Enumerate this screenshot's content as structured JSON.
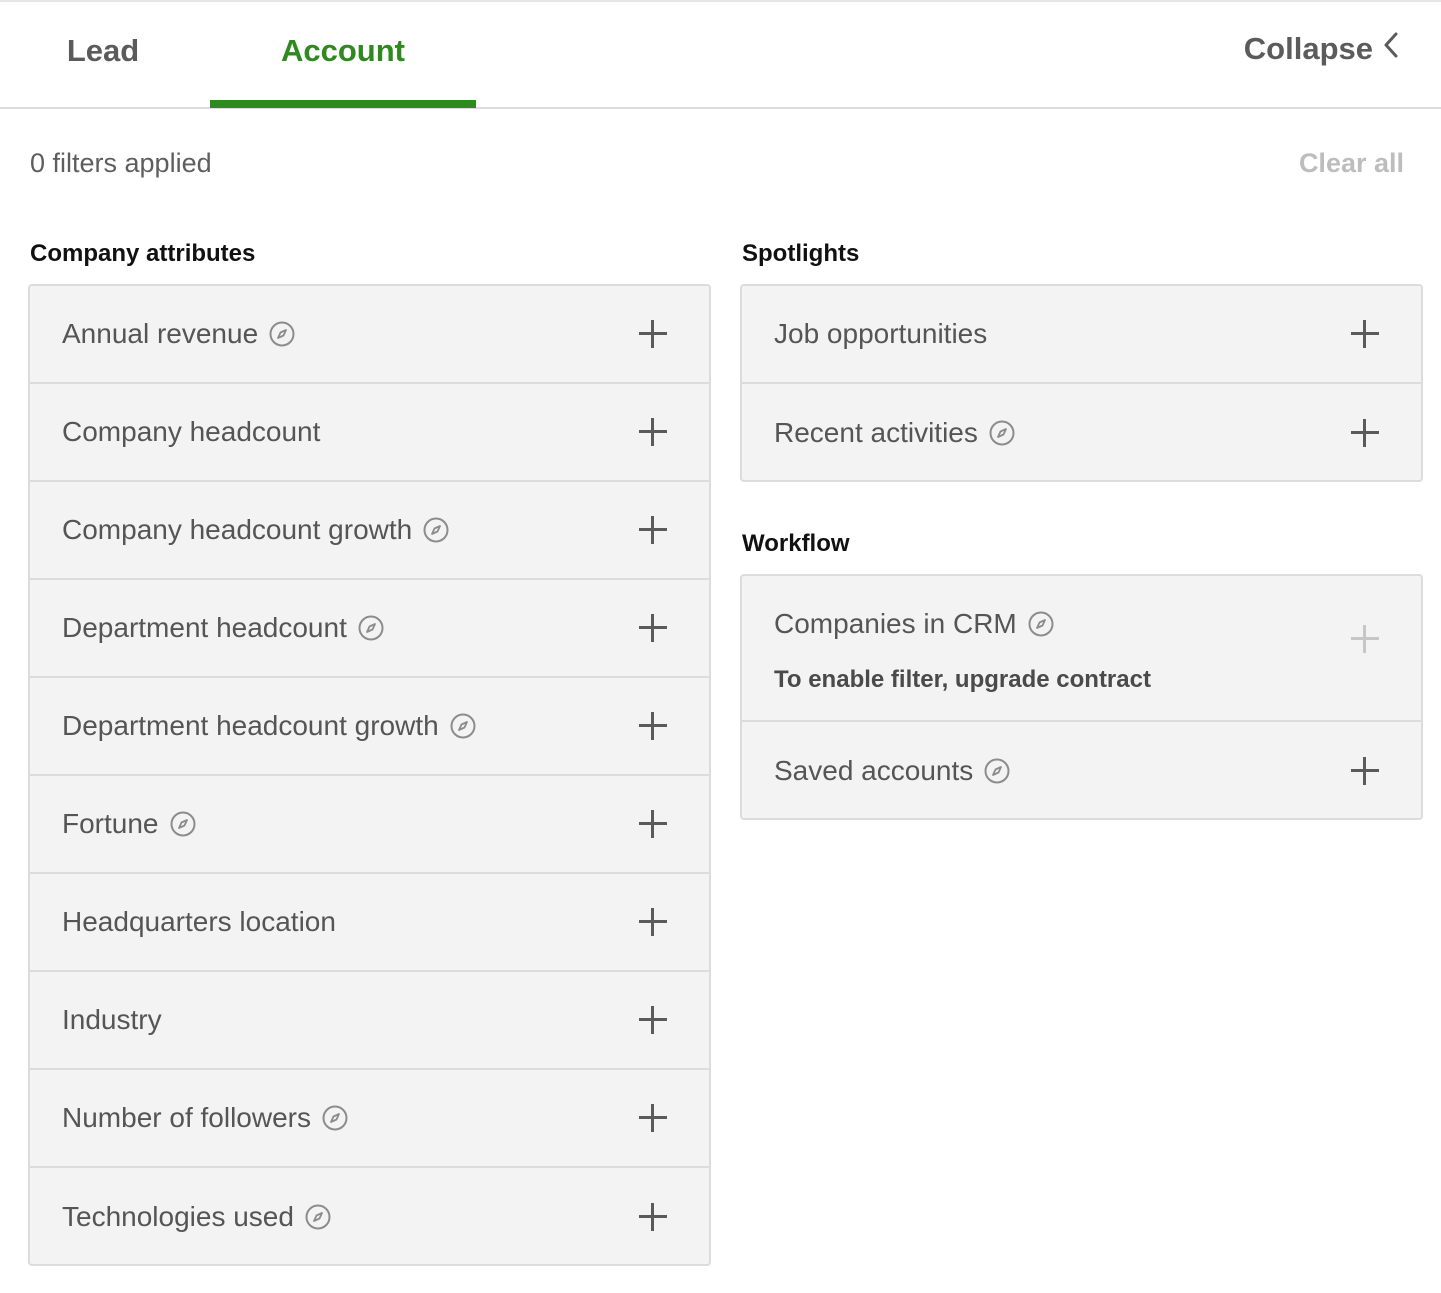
{
  "tabs": [
    {
      "label": "Lead",
      "active": false
    },
    {
      "label": "Account",
      "active": true
    }
  ],
  "header": {
    "collapse_label": "Collapse",
    "filters_applied": "0 filters applied",
    "clear_all": "Clear all"
  },
  "colors": {
    "accent": "#2e8a1e",
    "panel_bg": "#f3f3f4",
    "border": "#dcdcdc"
  },
  "company_attributes": {
    "title": "Company attributes",
    "items": [
      {
        "label": "Annual revenue",
        "info": true
      },
      {
        "label": "Company headcount",
        "info": false
      },
      {
        "label": "Company headcount growth",
        "info": true
      },
      {
        "label": "Department headcount",
        "info": true
      },
      {
        "label": "Department headcount growth",
        "info": true
      },
      {
        "label": "Fortune",
        "info": true
      },
      {
        "label": "Headquarters location",
        "info": false
      },
      {
        "label": "Industry",
        "info": false
      },
      {
        "label": "Number of followers",
        "info": true
      },
      {
        "label": "Technologies used",
        "info": true
      }
    ]
  },
  "spotlights": {
    "title": "Spotlights",
    "items": [
      {
        "label": "Job opportunities",
        "info": false
      },
      {
        "label": "Recent activities",
        "info": true
      }
    ]
  },
  "workflow": {
    "title": "Workflow",
    "items": [
      {
        "label": "Companies in CRM",
        "info": true,
        "disabled": true,
        "note": "To enable filter, upgrade contract"
      },
      {
        "label": "Saved accounts",
        "info": true
      }
    ]
  }
}
